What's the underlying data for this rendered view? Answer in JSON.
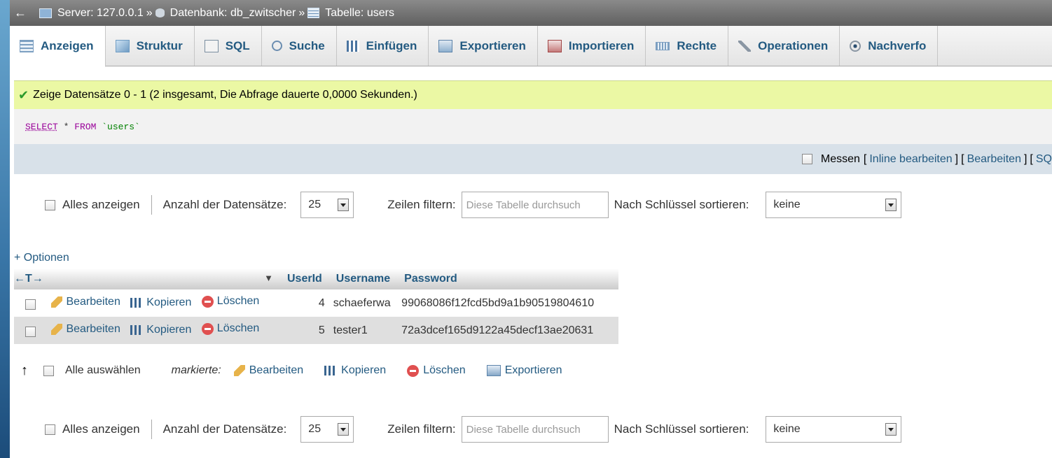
{
  "breadcrumb": {
    "back": "←",
    "server": "Server: 127.0.0.1",
    "database": "Datenbank: db_zwitscher",
    "table": "Tabelle: users",
    "separator": "»"
  },
  "tabs": [
    {
      "label": "Anzeigen",
      "icon": "browse-icon"
    },
    {
      "label": "Struktur",
      "icon": "structure-icon"
    },
    {
      "label": "SQL",
      "icon": "sql-icon"
    },
    {
      "label": "Suche",
      "icon": "search-icon"
    },
    {
      "label": "Einfügen",
      "icon": "insert-icon"
    },
    {
      "label": "Exportieren",
      "icon": "export-icon"
    },
    {
      "label": "Importieren",
      "icon": "import-icon"
    },
    {
      "label": "Rechte",
      "icon": "privileges-icon"
    },
    {
      "label": "Operationen",
      "icon": "wrench-icon"
    },
    {
      "label": "Nachverfo",
      "icon": "eye-icon"
    }
  ],
  "result": {
    "message": "Zeige Datensätze 0 - 1 (2 insgesamt, Die Abfrage dauerte 0,0000 Sekunden.)",
    "sql_select": "SELECT",
    "sql_star": " * ",
    "sql_from": "FROM",
    "sql_table": " `users`"
  },
  "sql_options": {
    "messen": "Messen",
    "bracket_open": "[",
    "bracket_close": "]",
    "inline_edit": "Inline bearbeiten",
    "edit": "Bearbeiten",
    "sql_cut": "SQ"
  },
  "nav": {
    "show_all": "Alles anzeigen",
    "row_count_label": "Anzahl der Datensätze:",
    "row_count_value": "25",
    "filter_label": "Zeilen filtern:",
    "filter_placeholder": "Diese Tabelle durchsuch",
    "sort_label": "Nach Schlüssel sortieren:",
    "sort_value": "keine"
  },
  "options_link": "+ Optionen",
  "table": {
    "arrows": "←T→",
    "sort_arrow": "▼",
    "headers": [
      "UserId",
      "Username",
      "Password"
    ],
    "actions": {
      "edit": "Bearbeiten",
      "copy": "Kopieren",
      "delete": "Löschen"
    },
    "rows": [
      {
        "id": "4",
        "username": "schaeferwa",
        "password": "99068086f12fcd5bd9a1b90519804610"
      },
      {
        "id": "5",
        "username": "tester1",
        "password": "72a3dcef165d9122a45decf13ae20631"
      }
    ]
  },
  "bulk": {
    "arrow": "↑",
    "select_all": "Alle auswählen",
    "marked": "markierte:",
    "edit": "Bearbeiten",
    "copy": "Kopieren",
    "delete": "Löschen",
    "export": "Exportieren"
  }
}
